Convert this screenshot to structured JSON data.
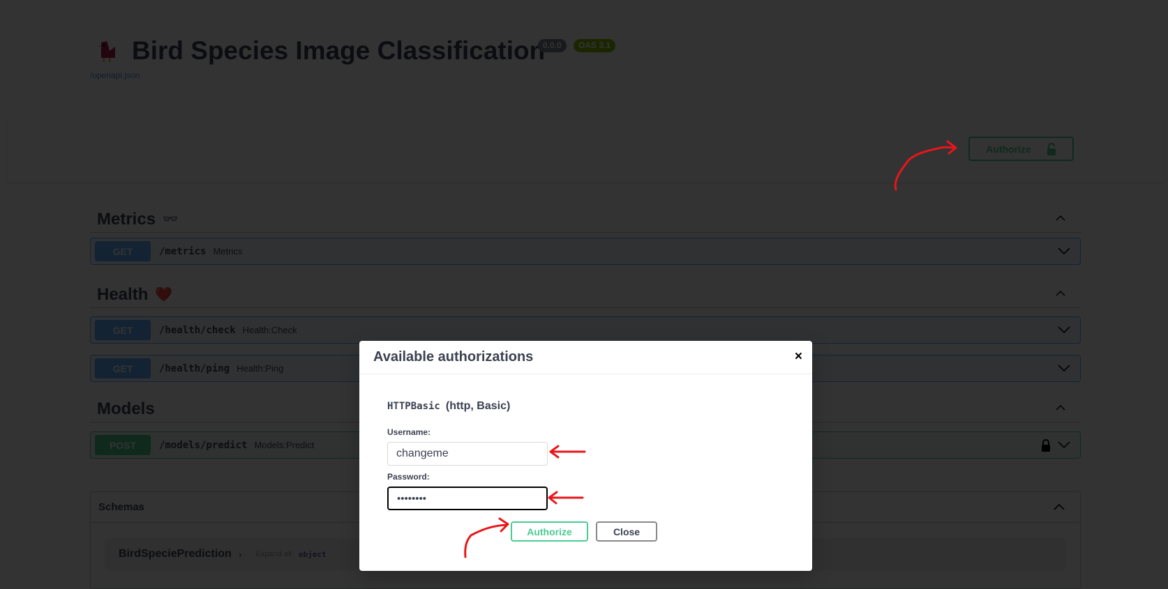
{
  "header": {
    "title": "Bird Species Image Classification",
    "version": "0.0.0",
    "oas": "OAS 3.1",
    "spec_link": "/openapi.json",
    "authorize_label": "Authorize"
  },
  "sections": [
    {
      "name": "Metrics",
      "emoji": "👓",
      "ops": [
        {
          "method": "GET",
          "path": "/metrics",
          "summary": "Metrics"
        }
      ]
    },
    {
      "name": "Health",
      "emoji": "❤️",
      "ops": [
        {
          "method": "GET",
          "path": "/health/check",
          "summary": "Health:Check"
        },
        {
          "method": "GET",
          "path": "/health/ping",
          "summary": "Health:Ping"
        }
      ]
    },
    {
      "name": "Models",
      "ops": [
        {
          "method": "POST",
          "path": "/models/predict",
          "summary": "Models:Predict"
        }
      ]
    }
  ],
  "schemas": {
    "title": "Schemas",
    "model_name": "BirdSpeciePrediction",
    "expand_all": "Expand all",
    "type": "object"
  },
  "modal": {
    "title": "Available authorizations",
    "close_icon": "×",
    "scheme_name": "HTTPBasic",
    "scheme_desc": "(http, Basic)",
    "username_label": "Username:",
    "username_value": "changeme",
    "password_label": "Password:",
    "password_value": "changeme",
    "authorize_label": "Authorize",
    "close_label": "Close"
  },
  "colors": {
    "get": "#61affe",
    "post": "#49cc90",
    "annotation": "#e8161b"
  }
}
